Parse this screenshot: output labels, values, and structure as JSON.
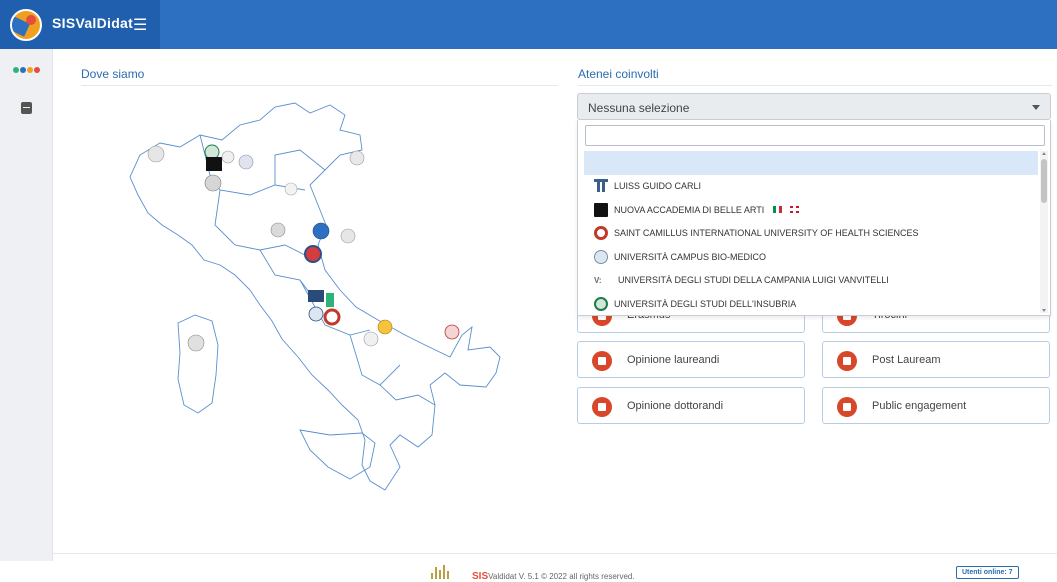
{
  "app": {
    "title": "SISValDidat",
    "menu_icon": "hamburger-icon"
  },
  "sidebar": {
    "dot_colors": [
      "#2db37a",
      "#2d6fc0",
      "#f0a020",
      "#e84c3d"
    ],
    "items": [
      "database-icon"
    ]
  },
  "map_section": {
    "title": "Dove siamo"
  },
  "atenei": {
    "title": "Atenei coinvolti",
    "selected": "Nessuna selezione",
    "search_value": "",
    "options": [
      {
        "label": "",
        "icon": ""
      },
      {
        "label": "LUISS GUIDO CARLI",
        "icon": "column-logo-icon"
      },
      {
        "label": "NUOVA ACCADEMIA DI BELLE ARTI",
        "icon": "black-square-logo-icon",
        "flags": [
          "italy-flag-icon",
          "uk-flag-icon"
        ]
      },
      {
        "label": "SAINT CAMILLUS INTERNATIONAL UNIVERSITY OF HEALTH SCIENCES",
        "icon": "red-ring-logo-icon"
      },
      {
        "label": "UNIVERSITÀ CAMPUS BIO-MEDICO",
        "icon": "blue-seal-icon"
      },
      {
        "label": "UNIVERSITÀ DEGLI STUDI DELLA CAMPANIA LUIGI VANVITELLI",
        "icon": "v-text-logo",
        "icon_text": "V:"
      },
      {
        "label": "UNIVERSITÀ DEGLI STUDI DELL'INSUBRIA",
        "icon": "green-seal-icon"
      }
    ]
  },
  "cards": [
    {
      "label": "Erasmus",
      "icon": "erasmus-icon"
    },
    {
      "label": "Tirocini",
      "icon": "tirocini-icon"
    },
    {
      "label": "Opinione laureandi",
      "icon": "graduation-cap-icon"
    },
    {
      "label": "Post Lauream",
      "icon": "building-icon"
    },
    {
      "label": "Opinione dottorandi",
      "icon": "document-icon"
    },
    {
      "label": "Public engagement",
      "icon": "public-engagement-icon"
    }
  ],
  "footer": {
    "brand_sis": "SIS",
    "brand_rest": "Valdidat",
    "version": "V. 5.1",
    "copyright": "© 2022 all rights reserved.",
    "online": "Utenti online: 7"
  },
  "colors": {
    "topbar": "#2d6fc0",
    "accent_red": "#d9472b",
    "link_blue": "#2b6cb0"
  }
}
